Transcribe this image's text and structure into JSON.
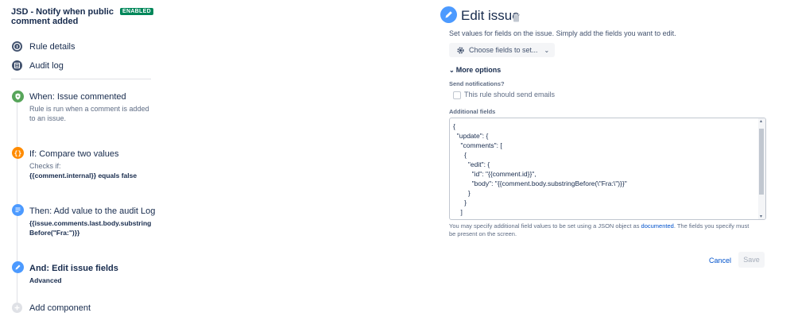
{
  "rule": {
    "title": "JSD - Notify when public comment added",
    "status_badge": "ENABLED"
  },
  "nav": {
    "rule_details": "Rule details",
    "audit_log": "Audit log"
  },
  "steps": [
    {
      "title": "When: Issue commented",
      "sub": "Rule is run when a comment is added to an issue."
    },
    {
      "title": "If: Compare two values",
      "sub": "Checks if:",
      "detail": "{{comment.internal}} equals false"
    },
    {
      "title": "Then: Add value to the audit Log",
      "detail_line1": "{{issue.comments.last.body.substring",
      "detail_line2": "Before(\"Fra:\")}}"
    },
    {
      "title": "And: Edit issue fields",
      "detail": "Advanced"
    }
  ],
  "add_component": "Add component",
  "editor": {
    "title": "Edit issue",
    "description": "Set values for fields on the issue. Simply add the fields you want to edit.",
    "choose_fields_label": "Choose fields to set...",
    "more_options_label": "More options",
    "send_notifications_label": "Send notifications?",
    "send_emails_label": "This rule should send emails",
    "additional_fields_label": "Additional fields",
    "code_lines": [
      "{",
      "  \"update\": {",
      "    \"comments\": [",
      "      {",
      "        \"edit\": {",
      "          \"id\": \"{{comment.id}}\",",
      "          \"body\": \"{{comment.body.substringBefore(\\\"Fra:\\\")}}\"",
      "        }",
      "      }",
      "    ]"
    ],
    "help_prefix": "You may specify additional field values to be set using a JSON object as ",
    "help_link": "documented",
    "help_suffix": ". The fields you specify must be present on the screen.",
    "cancel_label": "Cancel",
    "save_label": "Save"
  },
  "colors": {
    "accent_blue": "#4c9aff",
    "step_green": "#57a55a",
    "step_orange": "#ff8b00",
    "nav_gray": "#42526e",
    "enabled_green": "#00875a"
  },
  "icons": {
    "rule_details": "info-icon",
    "audit_log": "list-icon",
    "trigger": "shield-icon",
    "condition": "braces-icon",
    "action_log": "document-icon",
    "action_edit": "pencil-icon",
    "add": "plus-icon",
    "choose_fields": "gear-icon",
    "delete": "trash-icon"
  }
}
